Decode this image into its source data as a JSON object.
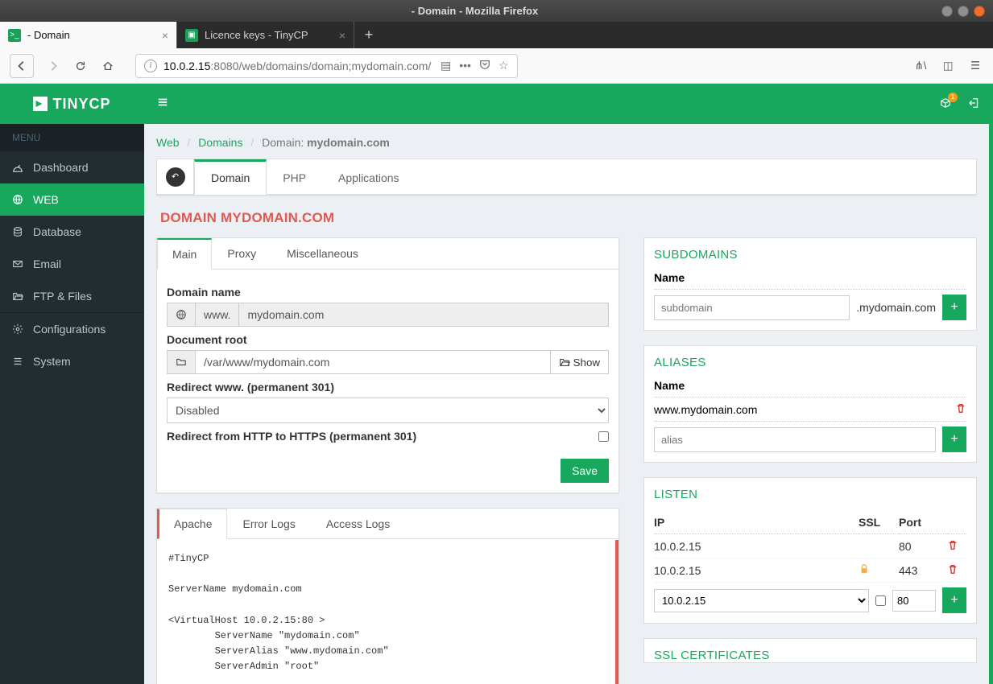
{
  "window": {
    "title": "- Domain - Mozilla Firefox"
  },
  "browser_tabs": [
    {
      "label": "- Domain",
      "active": true
    },
    {
      "label": "Licence keys - TinyCP",
      "active": false
    }
  ],
  "url": {
    "host": "10.0.2.15",
    "port": ":8080",
    "path": "/web/domains/domain;mydomain.com/"
  },
  "brand": "TINYCP",
  "sidebar": {
    "header": "MENU",
    "items": [
      {
        "label": "Dashboard",
        "icon": "dashboard"
      },
      {
        "label": "WEB",
        "icon": "globe",
        "active": true
      },
      {
        "label": "Database",
        "icon": "database"
      },
      {
        "label": "Email",
        "icon": "envelope"
      },
      {
        "label": "FTP & Files",
        "icon": "folder-open"
      },
      {
        "label": "Configurations",
        "icon": "cog"
      },
      {
        "label": "System",
        "icon": "list"
      }
    ]
  },
  "topbar": {
    "update_badge": "1"
  },
  "breadcrumb": {
    "web": "Web",
    "domains": "Domains",
    "current_prefix": "Domain: ",
    "current": "mydomain.com"
  },
  "feature_tabs": {
    "items": [
      "Domain",
      "PHP",
      "Applications"
    ],
    "active": 0
  },
  "page_title": "DOMAIN mydomain.com",
  "domain_tabs": {
    "items": [
      "Main",
      "Proxy",
      "Miscellaneous"
    ],
    "active": 0
  },
  "form": {
    "domain_label": "Domain name",
    "domain_www": "www.",
    "domain_value": "mydomain.com",
    "docroot_label": "Document root",
    "docroot_value": "/var/www/mydomain.com",
    "show_label": "Show",
    "redirect_www_label": "Redirect www. (permanent 301)",
    "redirect_www_value": "Disabled",
    "redirect_https_label": "Redirect from HTTP to HTTPS (permanent 301)",
    "save_label": "Save"
  },
  "log_tabs": {
    "items": [
      "Apache",
      "Error Logs",
      "Access Logs"
    ],
    "active": 0
  },
  "apache_config": "#TinyCP\n\nServerName mydomain.com\n\n<VirtualHost 10.0.2.15:80 >\n        ServerName \"mydomain.com\"\n        ServerAlias \"www.mydomain.com\"\n        ServerAdmin \"root\"",
  "subdomains": {
    "title": "SUBDOMAINS",
    "name_label": "Name",
    "placeholder": "subdomain",
    "suffix": ".mydomain.com"
  },
  "aliases": {
    "title": "ALIASES",
    "name_label": "Name",
    "items": [
      "www.mydomain.com"
    ],
    "placeholder": "alias"
  },
  "listen": {
    "title": "LISTEN",
    "cols": {
      "ip": "IP",
      "ssl": "SSL",
      "port": "Port"
    },
    "rows": [
      {
        "ip": "10.0.2.15",
        "ssl": false,
        "port": "80"
      },
      {
        "ip": "10.0.2.15",
        "ssl": true,
        "port": "443"
      }
    ],
    "new_ip": "10.0.2.15",
    "new_port": "80"
  },
  "ssl_box": {
    "title": "SSL CERTIFICATES"
  }
}
